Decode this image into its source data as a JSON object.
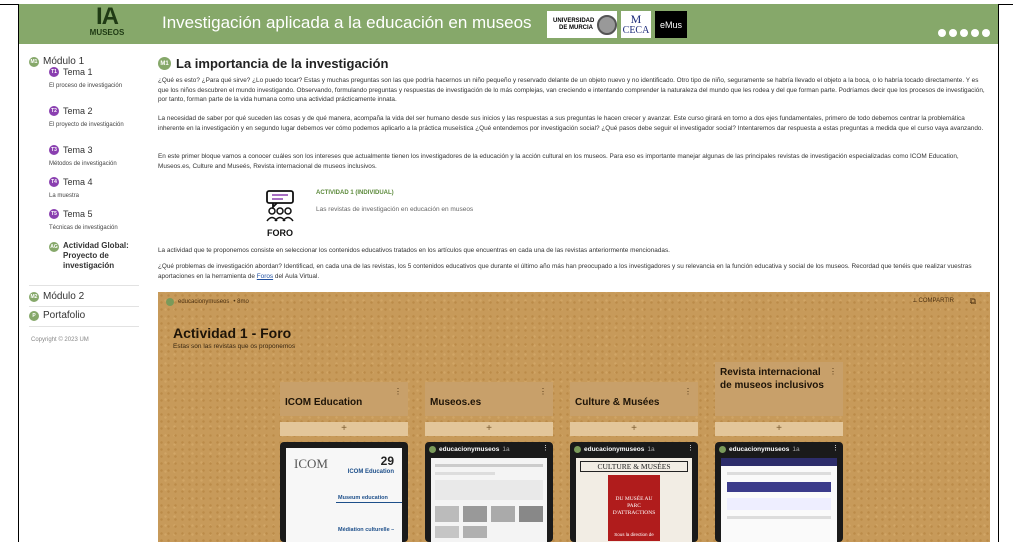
{
  "header": {
    "logo_big": "IA",
    "logo_small": "MUSEOS",
    "title": "Investigación aplicada a la educación en museos",
    "partners": {
      "murcia": "UNIVERSIDAD DE MURCIA",
      "ceca_mark": "M",
      "ceca": "CECA",
      "emus": "eMus"
    },
    "icons": [
      "home-icon",
      "back-icon",
      "add-icon",
      "menu-icon",
      "info-icon"
    ]
  },
  "sidebar": {
    "modulo1": {
      "badge": "M1",
      "label": "Módulo 1"
    },
    "temas": [
      {
        "badge": "T1",
        "label": "Tema 1",
        "sub": "El proceso de investigación"
      },
      {
        "badge": "T2",
        "label": "Tema 2",
        "sub": "El proyecto de investigación"
      },
      {
        "badge": "T3",
        "label": "Tema 3",
        "sub": "Métodos de investigación"
      },
      {
        "badge": "T4",
        "label": "Tema 4",
        "sub": "La muestra"
      },
      {
        "badge": "T5",
        "label": "Tema 5",
        "sub": "Técnicas de investigación"
      }
    ],
    "actividad": {
      "badge": "AG",
      "label": "Actividad Global: Proyecto de investigación"
    },
    "modulo2": {
      "badge": "M2",
      "label": "Módulo 2"
    },
    "portafolio": {
      "badge": "P",
      "label": "Portafolio"
    },
    "copyright": "Copyright © 2023 UM"
  },
  "main": {
    "badge": "M1",
    "title": "La importancia de la investigación",
    "p1": "¿Qué es esto? ¿Para qué sirve? ¿Lo puedo tocar? Estas y muchas preguntas son las que podría hacernos un niño pequeño y reservado delante de un objeto nuevo y no identificado. Otro tipo de niño, seguramente se habría llevado el objeto a la boca, o lo habría tocado directamente. Y es que los niños descubren el mundo investigando. Observando, formulando preguntas y respuestas de investigación de lo más complejas, van creciendo e intentando comprender la naturaleza del mundo que les rodea y del que forman parte. Podríamos decir que los procesos de investigación, por tanto, forman parte de la vida humana como una actividad prácticamente innata.",
    "p2": "La necesidad de saber por qué suceden las cosas y de qué manera, acompaña la vida del ser humano desde sus inicios y las respuestas a sus preguntas le hacen crecer y avanzar. Este curso girará en torno a dos ejes fundamentales, primero de todo debemos centrar la problemática inherente en la investigación y en segundo lugar debemos ver cómo podemos aplicarlo a la práctica museística ¿Qué entendemos por investigación social? ¿Qué pasos debe seguir el investigador social? Intentaremos dar respuesta a estas preguntas a medida que el curso vaya avanzando.",
    "p3": "En este primer bloque vamos a conocer cuáles son los intereses que actualmente tienen los investigadores de la educación y la acción cultural en los museos. Para eso es importante manejar algunas de las principales revistas de investigación especializadas como ICOM Education, Museos.es, Culture and Museés, Revista internacional de museos inclusivos.",
    "foro_label": "FORO",
    "actividad_title": "ACTIVIDAD 1 (INDIVIDUAL)",
    "actividad_desc": "Las revistas de investigación en educación en museos",
    "p4": "La actividad que te proponemos consiste en seleccionar los contenidos educativos tratados en los artículos que encuentras en cada una de las revistas anteriormente mencionadas.",
    "p5_before": "¿Qué problemas de investigación abordan? Identificad, en cada una de las revistas, los 5 contenidos educativos que durante el último año más han preocupado a los investigadores y su relevancia en la función educativa y social de los museos. Recordad que tenéis que realizar vuestras aportaciones en la herramienta de ",
    "p5_link": "Foros",
    "p5_after": " del Aula Virtual."
  },
  "padlet": {
    "user": "educacionymuseos",
    "user_time": "• 8mo",
    "share": "⟂ COMPARTIR",
    "title": "Actividad 1 - Foro",
    "subtitle": "Estas son las revistas que os proponemos",
    "columns": [
      {
        "name": "ICOM Education",
        "card_user": "",
        "card_time": "",
        "thumb_text": "ICOM",
        "thumb_num": "29",
        "thumb_sub": "ICOM Education",
        "thumb_a": "Museum education",
        "thumb_b": "Médiation culturelle –"
      },
      {
        "name": "Museos.es",
        "card_user": "educacionymuseos",
        "card_time": "1a",
        "thumb_text": ""
      },
      {
        "name": "Culture & Musées",
        "card_user": "educacionymuseos",
        "card_time": "1a",
        "thumb_text": "CULTURE & MUSÉES",
        "thumb_sub": "DU MUSÉE AU PARC D'ATTRACTIONS",
        "thumb_c": "Sous la direction de"
      },
      {
        "name": "Revista internacional de museos inclusivos",
        "card_user": "educacionymuseos",
        "card_time": "1a",
        "thumb_text": ""
      }
    ],
    "add": "+"
  }
}
